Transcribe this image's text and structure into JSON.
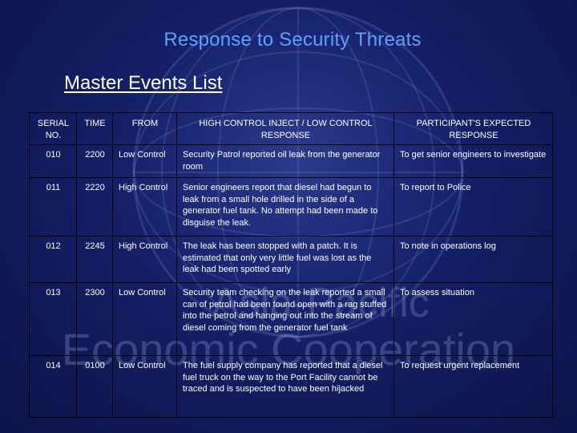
{
  "slide": {
    "title": "Response to Security Threats",
    "subtitle": "Master Events List",
    "watermark_text_line1": "Asia-Pacific",
    "watermark_text_line2": "Economic Cooperation",
    "colors": {
      "background": "#141f66",
      "title": "#5da0ff",
      "text": "#ffffff",
      "grid": "#000000"
    }
  },
  "table": {
    "headers": [
      "SERIAL NO.",
      "TIME",
      "FROM",
      "HIGH CONTROL INJECT / LOW CONTROL RESPONSE",
      "PARTICIPANT'S EXPECTED RESPONSE"
    ],
    "rows": [
      {
        "serial": "010",
        "time": "2200",
        "from": "Low Control",
        "inject": "Security Patrol reported oil leak from the generator room",
        "expected": "To get senior engineers to investigate"
      },
      {
        "serial": "011",
        "time": "2220",
        "from": "High Control",
        "inject": "Senior engineers report that diesel had begun to leak from a small hole drilled in the side of a generator fuel tank. No attempt had been made to disguise the leak.",
        "expected": "To report to Police"
      },
      {
        "serial": "012",
        "time": "2245",
        "from": "High Control",
        "inject": "The leak has been stopped with a patch. It is estimated that only very little fuel was lost as the leak had been spotted early",
        "expected": "To note in operations log"
      },
      {
        "serial": "013",
        "time": "2300",
        "from": "Low Control",
        "inject": "Security team checking on the leak reported a small can of petrol had been found open with a rag stuffed into the petrol and hanging out into the stream of diesel coming from the generator fuel tank",
        "expected": "To assess situation"
      },
      {
        "serial": "014",
        "time": "0100",
        "from": "Low Control",
        "inject": "The fuel supply company has reported that a diesel fuel truck on the way to the Port Facility cannot be traced and is suspected to have been hijacked",
        "expected": "To request urgent replacement"
      }
    ]
  }
}
